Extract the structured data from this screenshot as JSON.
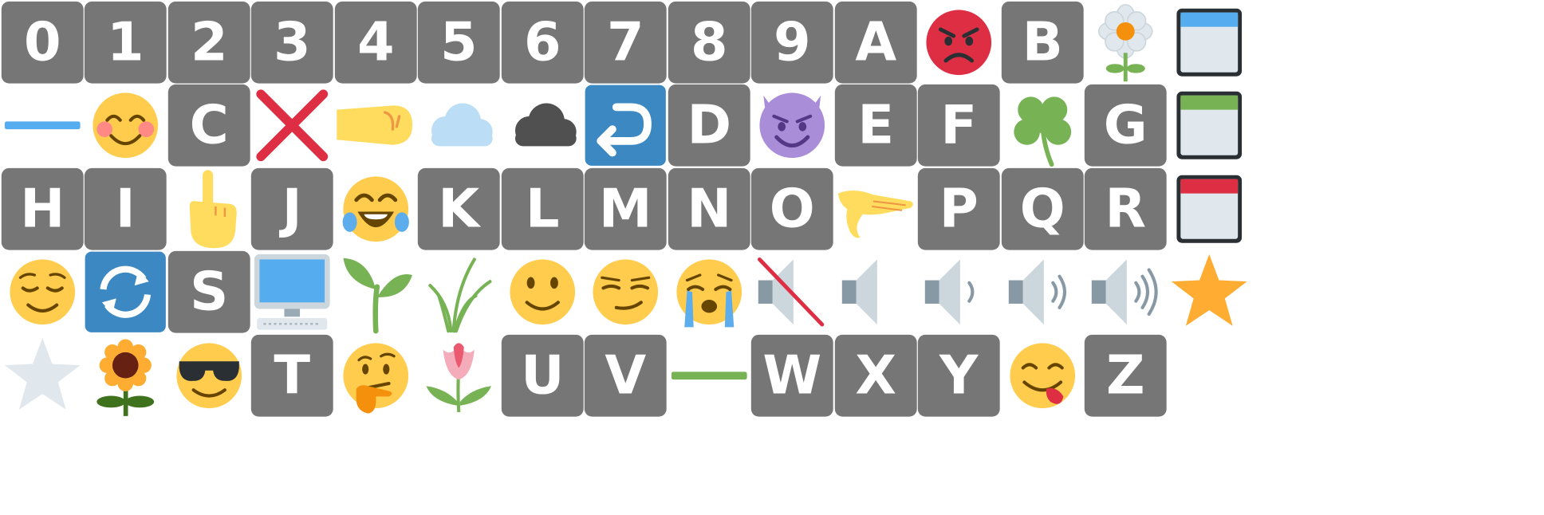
{
  "grid": {
    "columns": 15,
    "rows": 5
  },
  "cells": [
    {
      "kind": "key",
      "label": "0"
    },
    {
      "kind": "key",
      "label": "1"
    },
    {
      "kind": "key",
      "label": "2"
    },
    {
      "kind": "key",
      "label": "3"
    },
    {
      "kind": "key",
      "label": "4"
    },
    {
      "kind": "key",
      "label": "5"
    },
    {
      "kind": "key",
      "label": "6"
    },
    {
      "kind": "key",
      "label": "7"
    },
    {
      "kind": "key",
      "label": "8"
    },
    {
      "kind": "key",
      "label": "9"
    },
    {
      "kind": "key",
      "label": "A"
    },
    {
      "kind": "icon",
      "icon": "angry-face-icon"
    },
    {
      "kind": "key",
      "label": "B"
    },
    {
      "kind": "icon",
      "icon": "blossom-icon"
    },
    {
      "kind": "icon",
      "icon": "calendar-blue-icon"
    },
    {
      "kind": "icon",
      "icon": "blue-line-icon"
    },
    {
      "kind": "icon",
      "icon": "blushing-face-icon"
    },
    {
      "kind": "key",
      "label": "C"
    },
    {
      "kind": "icon",
      "icon": "cross-mark-icon"
    },
    {
      "kind": "icon",
      "icon": "fist-icon"
    },
    {
      "kind": "icon",
      "icon": "cloud-icon"
    },
    {
      "kind": "icon",
      "icon": "dark-cloud-icon"
    },
    {
      "kind": "icon",
      "icon": "return-arrow-icon"
    },
    {
      "kind": "key",
      "label": "D"
    },
    {
      "kind": "icon",
      "icon": "devil-face-icon"
    },
    {
      "kind": "key",
      "label": "E"
    },
    {
      "kind": "key",
      "label": "F"
    },
    {
      "kind": "icon",
      "icon": "four-leaf-clover-icon"
    },
    {
      "kind": "key",
      "label": "G"
    },
    {
      "kind": "icon",
      "icon": "calendar-green-icon"
    },
    {
      "kind": "key",
      "label": "H"
    },
    {
      "kind": "key",
      "label": "I"
    },
    {
      "kind": "icon",
      "icon": "pointing-up-hand-icon"
    },
    {
      "kind": "key",
      "label": "J"
    },
    {
      "kind": "icon",
      "icon": "tears-of-joy-face-icon"
    },
    {
      "kind": "key",
      "label": "K"
    },
    {
      "kind": "key",
      "label": "L"
    },
    {
      "kind": "key",
      "label": "M"
    },
    {
      "kind": "key",
      "label": "N"
    },
    {
      "kind": "key",
      "label": "O"
    },
    {
      "kind": "icon",
      "icon": "pinching-hand-icon"
    },
    {
      "kind": "key",
      "label": "P"
    },
    {
      "kind": "key",
      "label": "Q"
    },
    {
      "kind": "key",
      "label": "R"
    },
    {
      "kind": "icon",
      "icon": "calendar-red-icon"
    },
    {
      "kind": "icon",
      "icon": "relieved-face-icon"
    },
    {
      "kind": "icon",
      "icon": "refresh-arrows-icon"
    },
    {
      "kind": "key",
      "label": "S"
    },
    {
      "kind": "icon",
      "icon": "desktop-computer-icon"
    },
    {
      "kind": "icon",
      "icon": "seedling-icon"
    },
    {
      "kind": "icon",
      "icon": "grass-icon"
    },
    {
      "kind": "icon",
      "icon": "smiling-face-icon"
    },
    {
      "kind": "icon",
      "icon": "smirking-face-icon"
    },
    {
      "kind": "icon",
      "icon": "crying-face-icon"
    },
    {
      "kind": "icon",
      "icon": "speaker-muted-icon"
    },
    {
      "kind": "icon",
      "icon": "speaker-icon"
    },
    {
      "kind": "icon",
      "icon": "speaker-low-icon"
    },
    {
      "kind": "icon",
      "icon": "speaker-medium-icon"
    },
    {
      "kind": "icon",
      "icon": "speaker-loud-icon"
    },
    {
      "kind": "icon",
      "icon": "orange-star-icon"
    },
    {
      "kind": "icon",
      "icon": "grey-star-icon"
    },
    {
      "kind": "icon",
      "icon": "sunflower-icon"
    },
    {
      "kind": "icon",
      "icon": "sunglasses-face-icon"
    },
    {
      "kind": "key",
      "label": "T"
    },
    {
      "kind": "icon",
      "icon": "thinking-face-icon"
    },
    {
      "kind": "icon",
      "icon": "tulip-icon"
    },
    {
      "kind": "key",
      "label": "U"
    },
    {
      "kind": "key",
      "label": "V"
    },
    {
      "kind": "icon",
      "icon": "green-line-icon"
    },
    {
      "kind": "key",
      "label": "W"
    },
    {
      "kind": "key",
      "label": "X"
    },
    {
      "kind": "key",
      "label": "Y"
    },
    {
      "kind": "icon",
      "icon": "yum-face-icon"
    },
    {
      "kind": "key",
      "label": "Z"
    },
    {
      "kind": "empty"
    }
  ],
  "colors": {
    "key_background": "#767676",
    "key_text": "#ffffff",
    "emoji_yellow": "#FFCC4D",
    "angry_red": "#DD2E44",
    "blue": "#55ACEE",
    "box_blue": "#3B88C3",
    "devil_purple": "#AA8DD8",
    "clover_green": "#77B255",
    "star_orange": "#FFAC33",
    "star_grey": "#E1E8ED"
  }
}
